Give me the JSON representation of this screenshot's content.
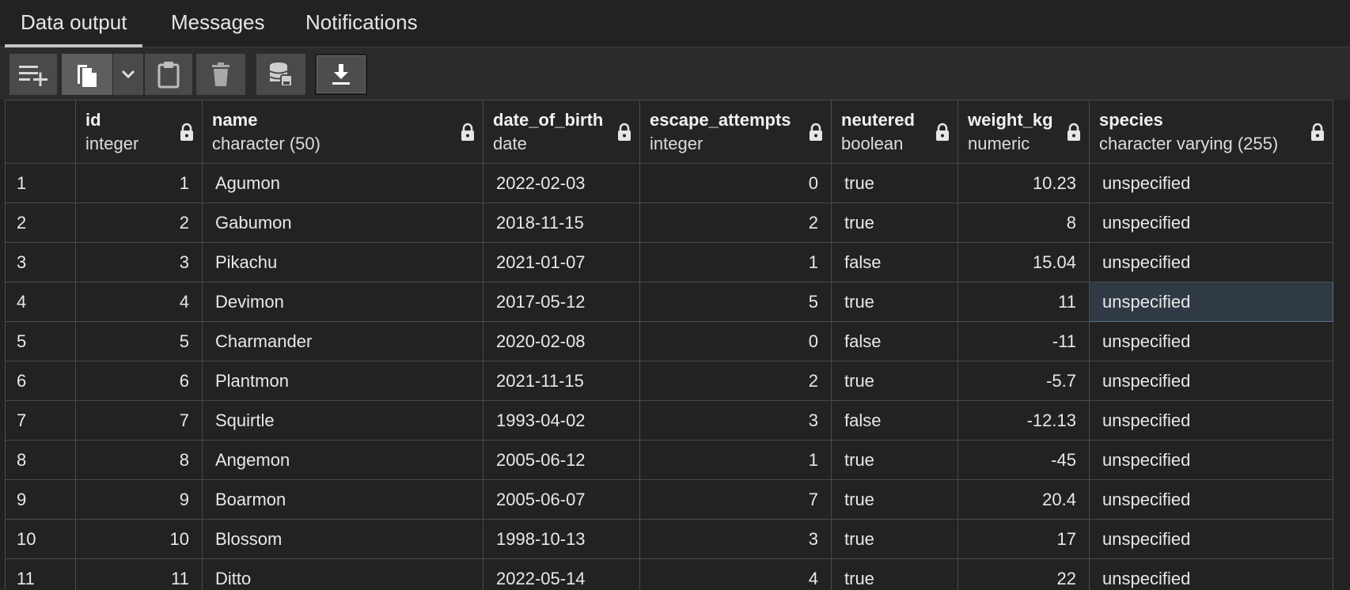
{
  "tabs": [
    {
      "label": "Data output",
      "active": true
    },
    {
      "label": "Messages",
      "active": false
    },
    {
      "label": "Notifications",
      "active": false
    }
  ],
  "toolbar": {
    "buttons": [
      {
        "icon": "add-row-icon"
      },
      {
        "icon": "copy-icon"
      },
      {
        "icon": "chevron-down-icon"
      },
      {
        "icon": "paste-icon"
      },
      {
        "icon": "delete-icon"
      },
      {
        "icon": "save-data-icon"
      },
      {
        "icon": "download-icon"
      }
    ]
  },
  "columns": [
    {
      "name": "id",
      "type": "integer"
    },
    {
      "name": "name",
      "type": "character (50)"
    },
    {
      "name": "date_of_birth",
      "type": "date"
    },
    {
      "name": "escape_attempts",
      "type": "integer"
    },
    {
      "name": "neutered",
      "type": "boolean"
    },
    {
      "name": "weight_kg",
      "type": "numeric"
    },
    {
      "name": "species",
      "type": "character varying (255)"
    }
  ],
  "rows": [
    {
      "n": "1",
      "id": "1",
      "name": "Agumon",
      "dob": "2022-02-03",
      "escapes": "0",
      "neutered": "true",
      "weight": "10.23",
      "species": "unspecified"
    },
    {
      "n": "2",
      "id": "2",
      "name": "Gabumon",
      "dob": "2018-11-15",
      "escapes": "2",
      "neutered": "true",
      "weight": "8",
      "species": "unspecified"
    },
    {
      "n": "3",
      "id": "3",
      "name": "Pikachu",
      "dob": "2021-01-07",
      "escapes": "1",
      "neutered": "false",
      "weight": "15.04",
      "species": "unspecified"
    },
    {
      "n": "4",
      "id": "4",
      "name": "Devimon",
      "dob": "2017-05-12",
      "escapes": "5",
      "neutered": "true",
      "weight": "11",
      "species": "unspecified"
    },
    {
      "n": "5",
      "id": "5",
      "name": "Charmander",
      "dob": "2020-02-08",
      "escapes": "0",
      "neutered": "false",
      "weight": "-11",
      "species": "unspecified"
    },
    {
      "n": "6",
      "id": "6",
      "name": "Plantmon",
      "dob": "2021-11-15",
      "escapes": "2",
      "neutered": "true",
      "weight": "-5.7",
      "species": "unspecified"
    },
    {
      "n": "7",
      "id": "7",
      "name": "Squirtle",
      "dob": "1993-04-02",
      "escapes": "3",
      "neutered": "false",
      "weight": "-12.13",
      "species": "unspecified"
    },
    {
      "n": "8",
      "id": "8",
      "name": "Angemon",
      "dob": "2005-06-12",
      "escapes": "1",
      "neutered": "true",
      "weight": "-45",
      "species": "unspecified"
    },
    {
      "n": "9",
      "id": "9",
      "name": "Boarmon",
      "dob": "2005-06-07",
      "escapes": "7",
      "neutered": "true",
      "weight": "20.4",
      "species": "unspecified"
    },
    {
      "n": "10",
      "id": "10",
      "name": "Blossom",
      "dob": "1998-10-13",
      "escapes": "3",
      "neutered": "true",
      "weight": "17",
      "species": "unspecified"
    },
    {
      "n": "11",
      "id": "11",
      "name": "Ditto",
      "dob": "2022-05-14",
      "escapes": "4",
      "neutered": "true",
      "weight": "22",
      "species": "unspecified"
    }
  ],
  "selected": {
    "row": 3,
    "column": "species"
  }
}
